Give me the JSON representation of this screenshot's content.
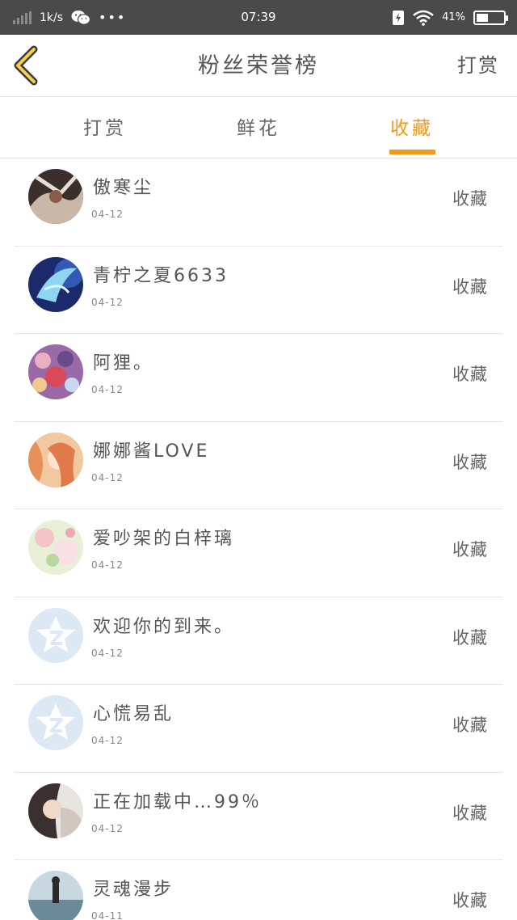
{
  "status_bar": {
    "speed": "1k/s",
    "dots": "•••",
    "time": "07:39",
    "battery": "41%"
  },
  "header": {
    "title": "粉丝荣誉榜",
    "action": "打赏"
  },
  "tabs": [
    {
      "label": "打赏",
      "active": false
    },
    {
      "label": "鲜花",
      "active": false
    },
    {
      "label": "收藏",
      "active": true
    }
  ],
  "colors": {
    "accent": "#f29a18",
    "status_bar_bg": "#4a4a4a"
  },
  "fans": [
    {
      "name": "傲寒尘",
      "date": "04-12",
      "action": "收藏",
      "avatar": "photo-dark"
    },
    {
      "name": "青柠之夏6633",
      "date": "04-12",
      "action": "收藏",
      "avatar": "photo-blue-bird"
    },
    {
      "name": "阿狸。",
      "date": "04-12",
      "action": "收藏",
      "avatar": "photo-anime-group"
    },
    {
      "name": "娜娜酱LOVE",
      "date": "04-12",
      "action": "收藏",
      "avatar": "photo-anime-orange"
    },
    {
      "name": "爱吵架的白梓璃",
      "date": "04-12",
      "action": "收藏",
      "avatar": "photo-pastel"
    },
    {
      "name": "欢迎你的到来。",
      "date": "04-12",
      "action": "收藏",
      "avatar": "default-avatar-icon"
    },
    {
      "name": "心慌易乱",
      "date": "04-12",
      "action": "收藏",
      "avatar": "default-avatar-icon"
    },
    {
      "name": "正在加载中…99％",
      "date": "04-12",
      "action": "收藏",
      "avatar": "photo-girl"
    },
    {
      "name": "灵魂漫步",
      "date": "04-11",
      "action": "收藏",
      "avatar": "photo-seaside"
    }
  ]
}
